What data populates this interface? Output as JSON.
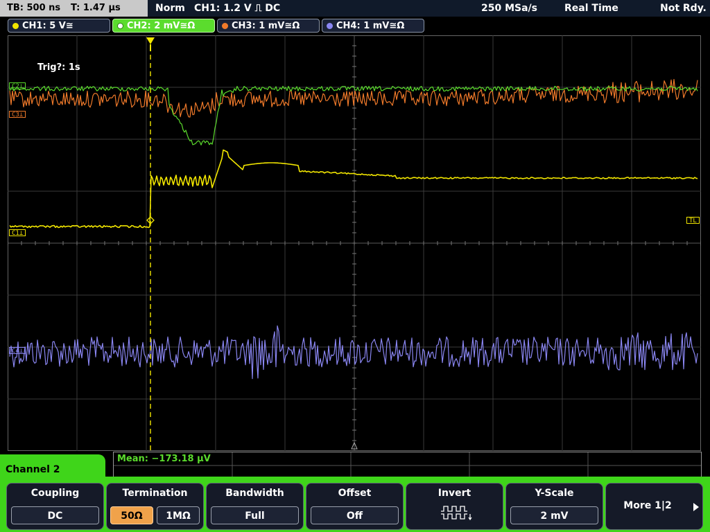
{
  "status": {
    "timebase": "TB: 500 ns",
    "trigger_time": "T: 1.47 µs",
    "mode": "Norm",
    "trigger_source": "CH1: 1.2 V ⎍ DC",
    "sample_rate": "250 MSa/s",
    "acq_mode": "Real Time",
    "ready_state": "Not Rdy."
  },
  "channels": [
    {
      "id": "ch1",
      "label": "CH1: 5 V≅",
      "color": "#f2e600",
      "active": false
    },
    {
      "id": "ch2",
      "label": "CH2: 2 mV≅Ω",
      "color": "#5bdc2d",
      "active": true
    },
    {
      "id": "ch3",
      "label": "CH3: 1 mV≅Ω",
      "color": "#f07a2a",
      "active": false
    },
    {
      "id": "ch4",
      "label": "CH4: 1 mV≅Ω",
      "color": "#8a86f2",
      "active": false
    }
  ],
  "screen": {
    "trigger_info": "Trig?: 1s",
    "markers": {
      "c2": "C2⊥",
      "c3": "C3⊥",
      "c1": "C1⊥",
      "c4": "C4⊥",
      "tl": "TL",
      "trigger_t": "T"
    }
  },
  "measurement": {
    "text": "Mean: −173.18 µV"
  },
  "menu": {
    "title": "Channel 2",
    "softkeys": [
      {
        "title": "Coupling",
        "value": "DC"
      },
      {
        "title": "Termination",
        "options": [
          "50Ω",
          "1MΩ"
        ],
        "selected": "50Ω"
      },
      {
        "title": "Bandwidth",
        "value": "Full"
      },
      {
        "title": "Offset",
        "value": "Off"
      },
      {
        "title": "Invert",
        "icon": "invert-pulse-icon"
      },
      {
        "title": "Y-Scale",
        "value": "2 mV"
      },
      {
        "title": "More 1|2",
        "icon": "arrow-right-icon"
      }
    ]
  }
}
